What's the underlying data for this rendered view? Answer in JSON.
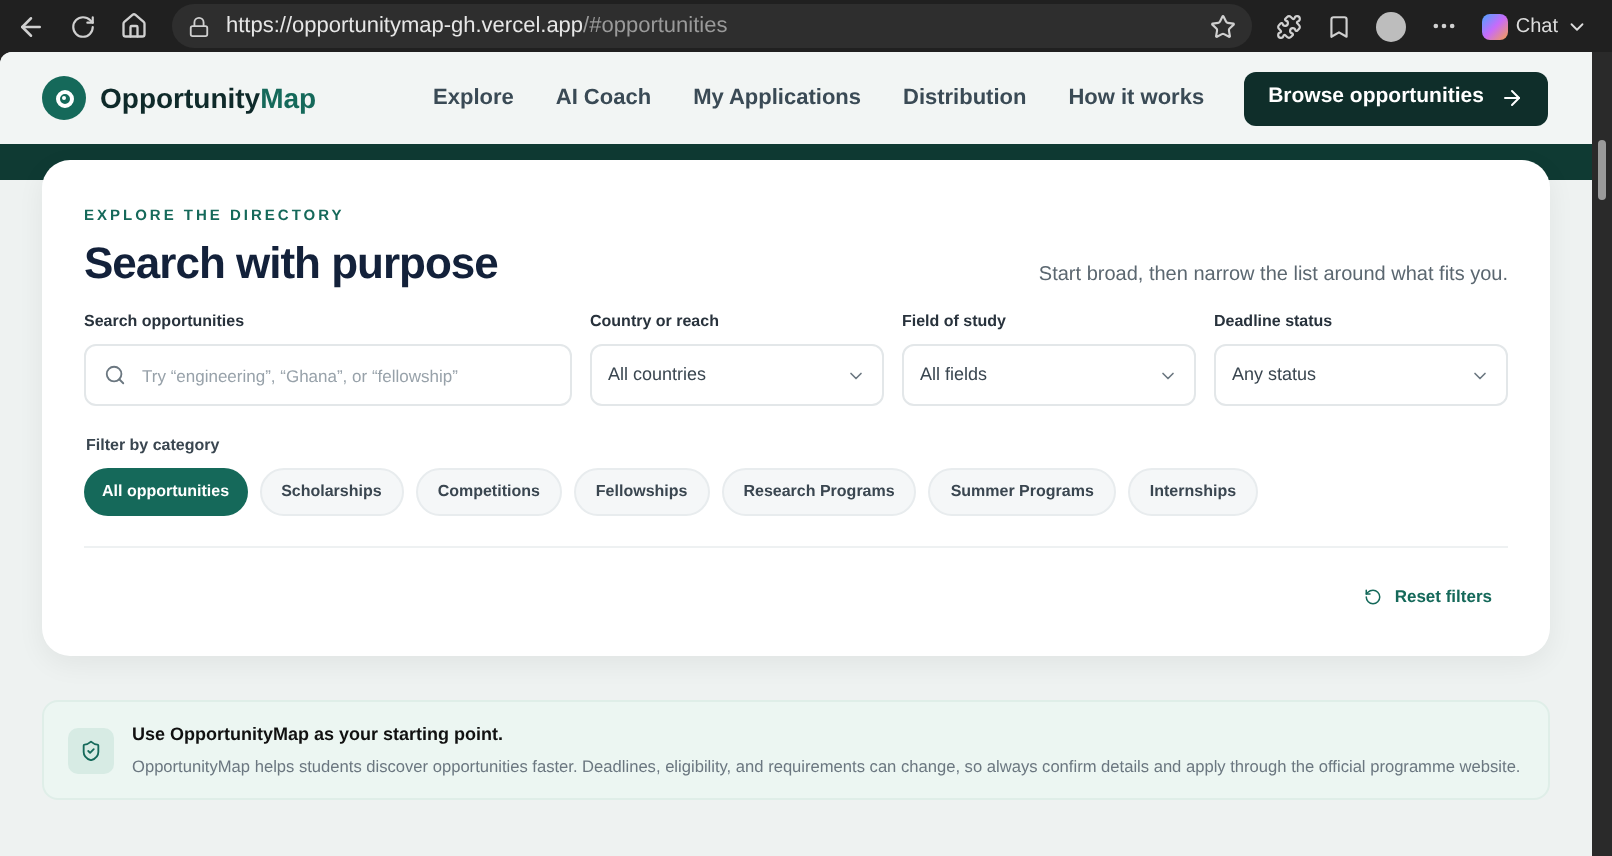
{
  "browser": {
    "url_host": "https://opportunitymap-gh.vercel.app",
    "url_path": "/#opportunities",
    "chat_label": "Chat"
  },
  "header": {
    "logo_primary": "Opportunity",
    "logo_accent": "Map",
    "nav": [
      {
        "label": "Explore"
      },
      {
        "label": "AI Coach"
      },
      {
        "label": "My Applications"
      },
      {
        "label": "Distribution"
      },
      {
        "label": "How it works"
      }
    ],
    "cta": "Browse opportunities"
  },
  "directory": {
    "eyebrow": "EXPLORE THE DIRECTORY",
    "title": "Search with purpose",
    "subtitle": "Start broad, then narrow the list around what fits you.",
    "fields": [
      {
        "kind": "search",
        "label": "Search opportunities",
        "placeholder": "Try “engineering”, “Ghana”, or “fellowship”"
      },
      {
        "kind": "select",
        "label": "Country or reach",
        "value": "All countries"
      },
      {
        "kind": "select",
        "label": "Field of study",
        "value": "All fields"
      },
      {
        "kind": "select",
        "label": "Deadline status",
        "value": "Any status"
      }
    ],
    "filter_label": "Filter by category",
    "categories": [
      {
        "label": "All opportunities",
        "selected": true
      },
      {
        "label": "Scholarships",
        "selected": false
      },
      {
        "label": "Competitions",
        "selected": false
      },
      {
        "label": "Fellowships",
        "selected": false
      },
      {
        "label": "Research Programs",
        "selected": false
      },
      {
        "label": "Summer Programs",
        "selected": false
      },
      {
        "label": "Internships",
        "selected": false
      }
    ],
    "reset": "Reset filters"
  },
  "notice": {
    "title": "Use OpportunityMap as your starting point.",
    "body": "OpportunityMap helps students discover opportunities faster. Deadlines, eligibility, and requirements can change, so always confirm details and apply through the official programme website."
  }
}
